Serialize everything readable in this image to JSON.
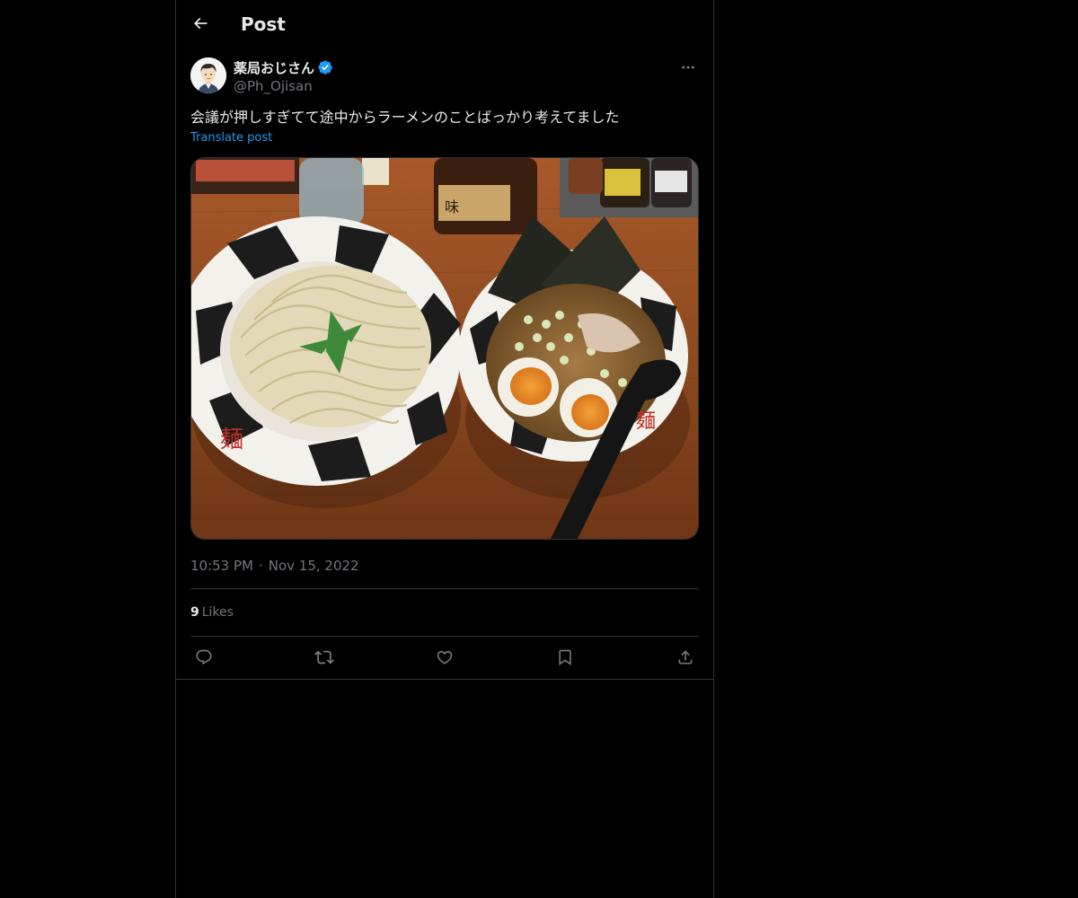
{
  "header": {
    "title": "Post",
    "back_icon": "arrow-left-icon"
  },
  "post": {
    "author": {
      "name": "薬局おじさん",
      "handle": "@Ph_Ojisan",
      "verified": true,
      "avatar_icon": "avatar-illustration"
    },
    "more_icon": "ellipsis-icon",
    "text": "会議が押しすぎてて途中からラーメンのことばっかり考えてました",
    "translate_label": "Translate post",
    "media": {
      "kind": "photo"
    },
    "time": "10:53 PM",
    "date": "Nov 15, 2022",
    "separator": "·",
    "likes_count": "9",
    "likes_label": "Likes"
  },
  "actions": [
    {
      "name": "reply",
      "icon": "reply-icon"
    },
    {
      "name": "repost",
      "icon": "repost-icon"
    },
    {
      "name": "like",
      "icon": "heart-icon"
    },
    {
      "name": "bookmark",
      "icon": "bookmark-icon"
    },
    {
      "name": "share",
      "icon": "share-icon"
    }
  ],
  "colors": {
    "background": "#000000",
    "text": "#e7e9ea",
    "secondary": "#71767b",
    "border": "#2f3336",
    "accent": "#1d9bf0"
  }
}
